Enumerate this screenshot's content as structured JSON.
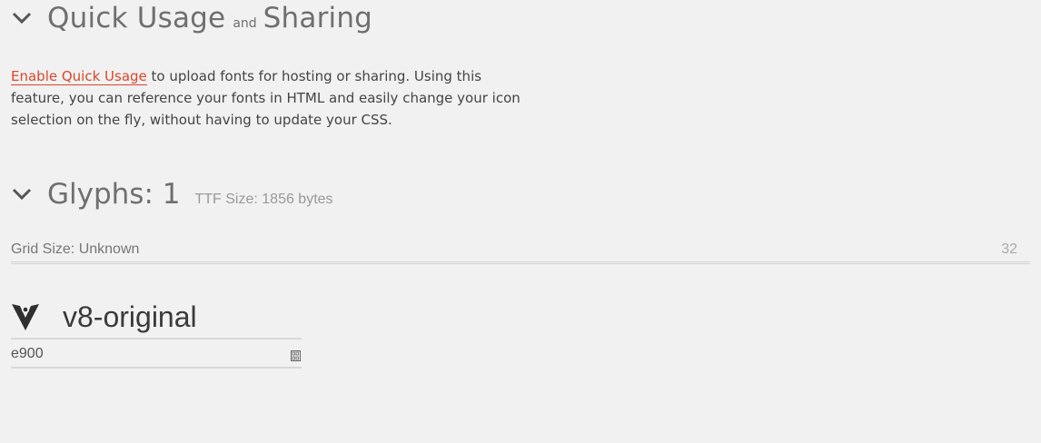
{
  "quick_usage": {
    "title_part1": "Quick Usage",
    "title_and": "and",
    "title_part2": "Sharing",
    "chevron_icon": "chevron-down-icon",
    "enable_link": "Enable Quick Usage",
    "description_rest": " to upload fonts for hosting or sharing. Using this feature, you can reference your fonts in HTML and easily change your icon selection on the fly, without having to update your CSS."
  },
  "glyphs": {
    "title": "Glyphs: 1",
    "ttf_size": "TTF Size: 1856 bytes",
    "chevron_icon": "chevron-down-icon",
    "grid_label": "Grid Size: Unknown",
    "grid_value": "32",
    "items": [
      {
        "name": "v8-original",
        "code": "e900",
        "icon": "v8-logo-icon"
      }
    ]
  },
  "colors": {
    "background": "#f1f1f1",
    "link": "#d9472b",
    "heading": "#6f6f6f"
  }
}
